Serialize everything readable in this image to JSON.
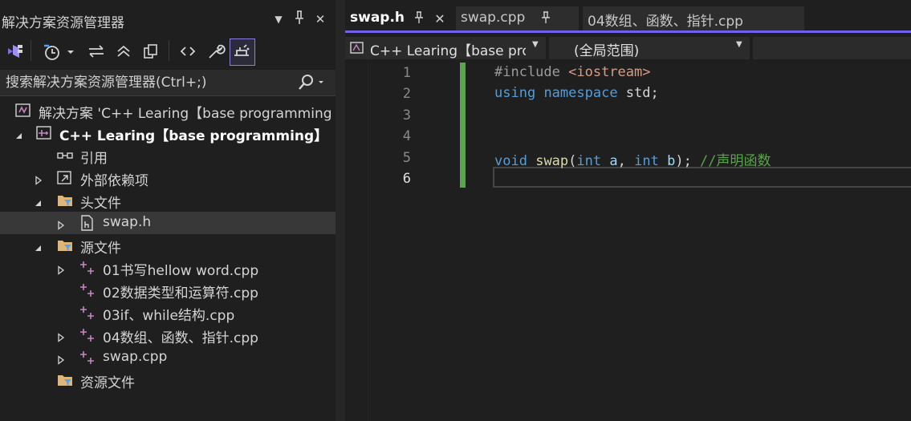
{
  "explorer": {
    "title": "解决方案资源管理器",
    "title_buttons": [
      "▼",
      "⊣",
      "✕"
    ],
    "search_placeholder": "搜索解决方案资源管理器(Ctrl+;)",
    "tree": [
      {
        "label": "解决方案 'C++ Learing【base programming",
        "level": 0,
        "icon": "solution-icon",
        "expander": "none"
      },
      {
        "label": "C++ Learing【base programming】",
        "level": 1,
        "icon": "project-icon",
        "expander": "expanded",
        "bold": true
      },
      {
        "label": "引用",
        "level": 2,
        "icon": "references-icon",
        "expander": "none"
      },
      {
        "label": "外部依赖项",
        "level": 2,
        "icon": "external-deps-icon",
        "expander": "collapsed"
      },
      {
        "label": "头文件",
        "level": 2,
        "icon": "filter-folder-icon",
        "expander": "expanded"
      },
      {
        "label": "swap.h",
        "level": 3,
        "icon": "header-file-icon",
        "expander": "collapsed",
        "selected": true
      },
      {
        "label": "源文件",
        "level": 2,
        "icon": "filter-folder-icon",
        "expander": "expanded"
      },
      {
        "label": "01书写hellow word.cpp",
        "level": 3,
        "icon": "cpp-file-icon",
        "expander": "collapsed"
      },
      {
        "label": "02数据类型和运算符.cpp",
        "level": 3,
        "icon": "cpp-file-icon",
        "expander": "none"
      },
      {
        "label": "03if、while结构.cpp",
        "level": 3,
        "icon": "cpp-file-icon",
        "expander": "none"
      },
      {
        "label": "04数组、函数、指针.cpp",
        "level": 3,
        "icon": "cpp-file-icon",
        "expander": "collapsed"
      },
      {
        "label": "swap.cpp",
        "level": 3,
        "icon": "cpp-file-icon",
        "expander": "collapsed"
      },
      {
        "label": "资源文件",
        "level": 2,
        "icon": "filter-folder-icon",
        "expander": "none"
      }
    ]
  },
  "editor": {
    "tabs": [
      {
        "label": "swap.h",
        "active": true
      },
      {
        "label": "swap.cpp",
        "active": false
      },
      {
        "label": "04数组、函数、指针.cpp",
        "active": false
      }
    ],
    "nav": {
      "project": "C++ Learing【base pro",
      "scope": "(全局范围)"
    },
    "current_line": 6,
    "lines": [
      {
        "n": "1",
        "tokens": [
          {
            "t": "#include ",
            "c": "pre"
          },
          {
            "t": "<iostream>",
            "c": "str"
          }
        ]
      },
      {
        "n": "2",
        "tokens": [
          {
            "t": "using",
            "c": "kw"
          },
          {
            "t": " ",
            "c": "plain"
          },
          {
            "t": "namespace",
            "c": "kw"
          },
          {
            "t": " std;",
            "c": "plain"
          }
        ]
      },
      {
        "n": "3",
        "tokens": []
      },
      {
        "n": "4",
        "tokens": []
      },
      {
        "n": "5",
        "tokens": [
          {
            "t": "void",
            "c": "kw"
          },
          {
            "t": " ",
            "c": "plain"
          },
          {
            "t": "swap",
            "c": "fn"
          },
          {
            "t": "(",
            "c": "plain"
          },
          {
            "t": "int",
            "c": "kw"
          },
          {
            "t": " ",
            "c": "plain"
          },
          {
            "t": "a",
            "c": "param"
          },
          {
            "t": ", ",
            "c": "plain"
          },
          {
            "t": "int",
            "c": "kw"
          },
          {
            "t": " ",
            "c": "plain"
          },
          {
            "t": "b",
            "c": "param"
          },
          {
            "t": "); ",
            "c": "plain"
          },
          {
            "t": "//声明函数",
            "c": "cmt"
          }
        ]
      },
      {
        "n": "6",
        "tokens": []
      }
    ]
  },
  "colors": {
    "accent": "#7160e8",
    "change_bar": "#57a64a",
    "background": "#1f1f1f"
  }
}
